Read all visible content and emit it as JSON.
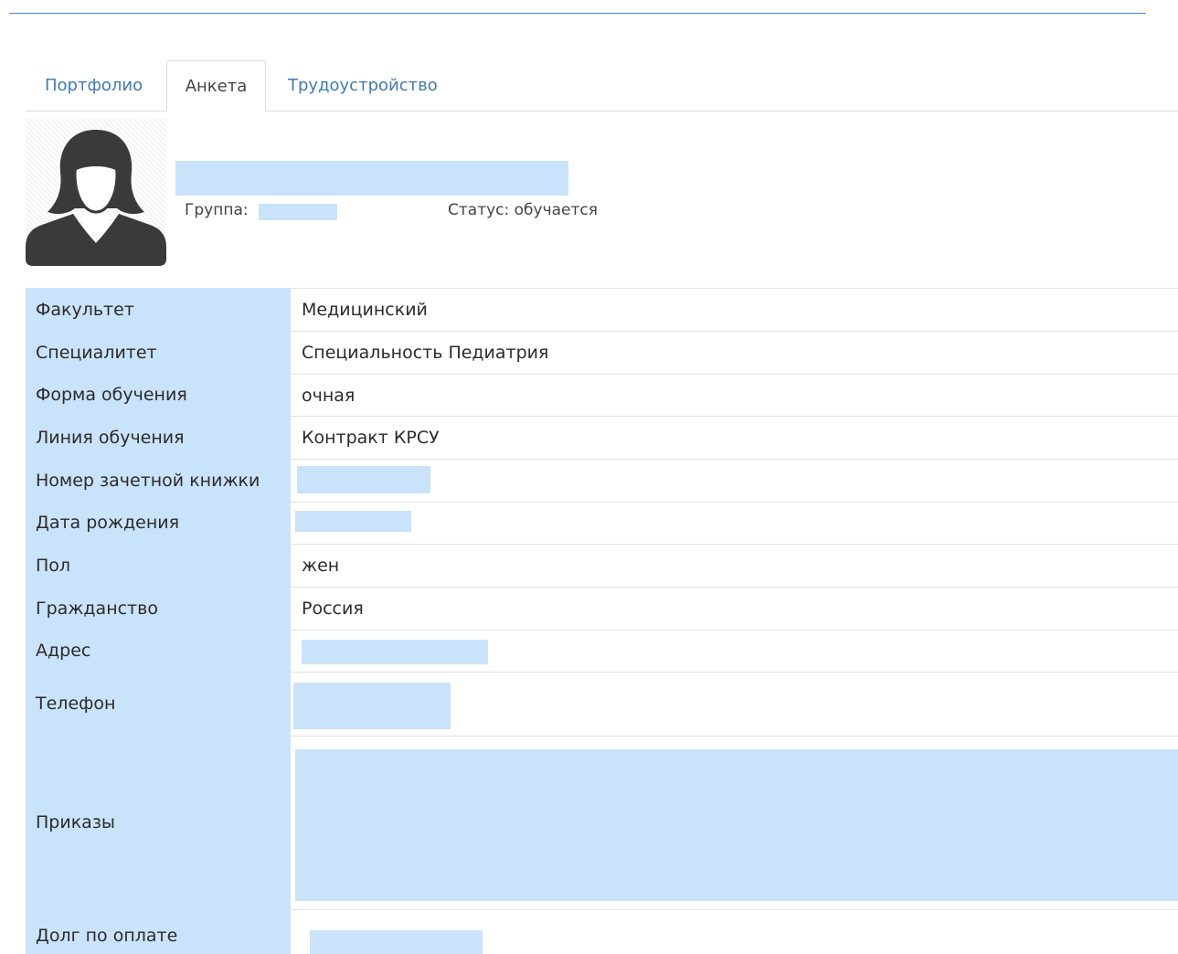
{
  "tabs": [
    {
      "label": "Портфолио",
      "active": false
    },
    {
      "label": "Анкета",
      "active": true
    },
    {
      "label": "Трудоустройство",
      "active": false
    }
  ],
  "profile": {
    "group_label": "Группа:",
    "status_label": "Статус: обучается"
  },
  "table": {
    "faculty": {
      "label": "Факультет",
      "value": "Медицинский"
    },
    "specialty": {
      "label": "Специалитет",
      "value": "Специальность Педиатрия"
    },
    "study_form": {
      "label": "Форма обучения",
      "value": "очная"
    },
    "study_line": {
      "label": "Линия обучения",
      "value": "Контракт КРСУ"
    },
    "record_book": {
      "label": "Номер зачетной книжки"
    },
    "birth_date": {
      "label": "Дата рождения"
    },
    "gender": {
      "label": "Пол",
      "value": "жен"
    },
    "citizenship": {
      "label": "Гражданство",
      "value": "Россия"
    },
    "address": {
      "label": "Адрес"
    },
    "phone": {
      "label": "Телефон"
    },
    "orders": {
      "label": "Приказы"
    },
    "payment_debt": {
      "label": "Долг по оплате"
    }
  },
  "colors": {
    "accent": "#3f7ab8",
    "label_background": "#c9e3fa",
    "redaction": "#c9e3fa",
    "top_rule": "#4a82c7"
  },
  "icons": {
    "avatar": "female-user-silhouette-icon"
  }
}
